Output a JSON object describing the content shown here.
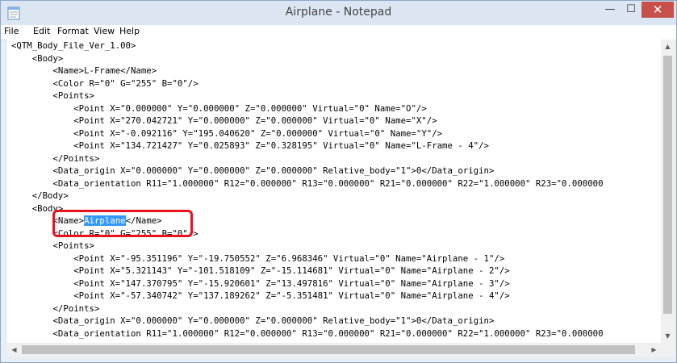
{
  "window": {
    "title": "Airplane - Notepad",
    "minimize_glyph": "—",
    "maximize_glyph": "☐",
    "close_glyph": "✕",
    "icon": "notepad-icon"
  },
  "menu": [
    "File",
    "Edit",
    "Format",
    "View",
    "Help"
  ],
  "editor": {
    "lines": [
      "<QTM_Body_File_Ver_1.00>",
      "    <Body>",
      "        <Name>L-Frame</Name>",
      "        <Color R=\"0\" G=\"255\" B=\"0\"/>",
      "        <Points>",
      "            <Point X=\"0.000000\" Y=\"0.000000\" Z=\"0.000000\" Virtual=\"0\" Name=\"O\"/>",
      "            <Point X=\"270.042721\" Y=\"0.000000\" Z=\"0.000000\" Virtual=\"0\" Name=\"X\"/>",
      "            <Point X=\"-0.092116\" Y=\"195.040620\" Z=\"0.000000\" Virtual=\"0\" Name=\"Y\"/>",
      "            <Point X=\"134.721427\" Y=\"0.025893\" Z=\"0.328195\" Virtual=\"0\" Name=\"L-Frame - 4\"/>",
      "        </Points>",
      "        <Data_origin X=\"0.000000\" Y=\"0.000000\" Z=\"0.000000\" Relative_body=\"1\">0</Data_origin>",
      "        <Data_orientation R11=\"1.000000\" R12=\"0.000000\" R13=\"0.000000\" R21=\"0.000000\" R22=\"1.000000\" R23=\"0.000000",
      "    </Body>",
      "    <Body>",
      "        <Name>Airplane</Name>",
      "        <Color R=\"0\" G=\"255\" B=\"0\"/>",
      "        <Points>",
      "            <Point X=\"-95.351196\" Y=\"-19.750552\" Z=\"6.968346\" Virtual=\"0\" Name=\"Airplane - 1\"/>",
      "            <Point X=\"5.321143\" Y=\"-101.518109\" Z=\"-15.114681\" Virtual=\"0\" Name=\"Airplane - 2\"/>",
      "            <Point X=\"147.370795\" Y=\"-15.920601\" Z=\"13.497816\" Virtual=\"0\" Name=\"Airplane - 3\"/>",
      "            <Point X=\"-57.340742\" Y=\"137.189262\" Z=\"-5.351481\" Virtual=\"0\" Name=\"Airplane - 4\"/>",
      "        </Points>",
      "        <Data_origin X=\"0.000000\" Y=\"0.000000\" Z=\"0.000000\" Relative_body=\"1\">0</Data_origin>",
      "        <Data_orientation R11=\"1.000000\" R12=\"0.000000\" R13=\"0.000000\" R21=\"0.000000\" R22=\"1.000000\" R23=\"0.000000"
    ],
    "selection": {
      "line": 14,
      "prefix": "        <Name>",
      "selected": "Airplane",
      "suffix": "</Name>"
    }
  },
  "colors": {
    "selection": "#3399ff",
    "annotation_box": "#e8131f",
    "close_button": "#c7504b",
    "titlebar": "#dce6f2"
  },
  "scrollbars": {
    "up": "▲",
    "down": "▼",
    "left": "◀",
    "right": "▶"
  }
}
